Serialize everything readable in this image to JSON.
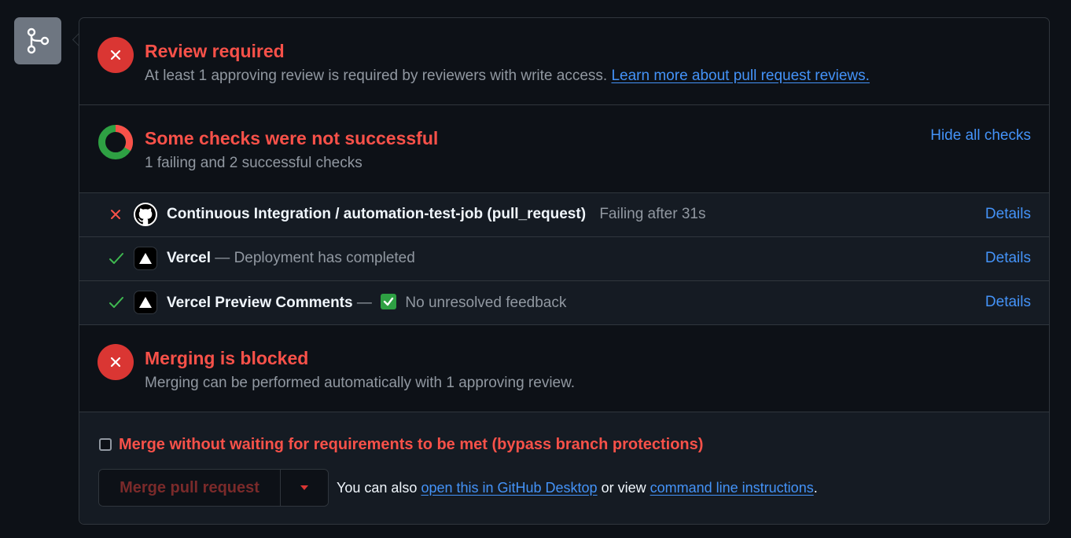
{
  "review": {
    "title": "Review required",
    "subtitle": "At least 1 approving review is required by reviewers with write access.",
    "link": "Learn more about pull request reviews."
  },
  "checks": {
    "title": "Some checks were not successful",
    "subtitle": "1 failing and 2 successful checks",
    "toggle": "Hide all checks",
    "items": [
      {
        "status": "failed",
        "icon": "github-icon",
        "name": "Continuous Integration / automation-test-job (pull_request)",
        "detail": "Failing after 31s",
        "action": "Details"
      },
      {
        "status": "success",
        "icon": "vercel-icon",
        "name": "Vercel",
        "separator": "—",
        "detail": "Deployment has completed",
        "action": "Details"
      },
      {
        "status": "success",
        "icon": "vercel-icon",
        "name": "Vercel Preview Comments",
        "separator": "—",
        "detail": "No unresolved feedback",
        "action": "Details"
      }
    ]
  },
  "merge_blocked": {
    "title": "Merging is blocked",
    "subtitle": "Merging can be performed automatically with 1 approving review."
  },
  "footer": {
    "bypass_label": "Merge without waiting for requirements to be met (bypass branch protections)",
    "bypass_checked": false,
    "merge_button": "Merge pull request",
    "also_prefix": "You can also",
    "desktop_link": "open this in GitHub Desktop",
    "or_view": "or view",
    "cli_link": "command line instructions",
    "period": "."
  },
  "colors": {
    "danger": "#f85149",
    "success": "#3fb950",
    "link": "#4493f8",
    "border": "#30363d",
    "background": "#0d1117"
  }
}
